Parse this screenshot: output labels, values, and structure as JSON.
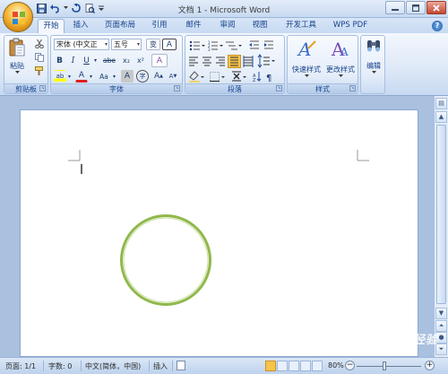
{
  "window": {
    "title": "文档 1 - Microsoft Word"
  },
  "quick_access": {
    "icons": [
      "save-icon",
      "undo-icon",
      "redo-icon",
      "print-preview-icon",
      "customize-dropdown-icon"
    ]
  },
  "tabs": [
    {
      "label": "开始",
      "active": true
    },
    {
      "label": "插入",
      "active": false
    },
    {
      "label": "页面布局",
      "active": false
    },
    {
      "label": "引用",
      "active": false
    },
    {
      "label": "邮件",
      "active": false
    },
    {
      "label": "审阅",
      "active": false
    },
    {
      "label": "视图",
      "active": false
    },
    {
      "label": "开发工具",
      "active": false
    },
    {
      "label": "WPS PDF",
      "active": false
    }
  ],
  "ribbon": {
    "clipboard": {
      "paste_label": "粘贴",
      "group_label": "剪贴板"
    },
    "font": {
      "font_name": "宋体 (中文正",
      "font_size": "五号",
      "phonetic_glyph": "变",
      "border_glyph": "A",
      "bold": "B",
      "italic": "I",
      "underline": "U",
      "strike": "abe",
      "subscript": "x₂",
      "superscript": "x²",
      "clear_glyph": "A",
      "highlight_glyph": "ab",
      "font_color_glyph": "A",
      "case_glyph": "Aa",
      "shade_glyph": "A",
      "enclose_glyph": "字",
      "grow_glyph": "A",
      "shrink_glyph": "A",
      "group_label": "字体"
    },
    "paragraph": {
      "group_label": "段落"
    },
    "styles": {
      "quick_label": "快速样式",
      "change_label": "更改样式",
      "group_label": "样式"
    },
    "editing": {
      "label": "编辑"
    },
    "colors": {
      "accent_blue": "#15428b",
      "font_color_red": "#e02020",
      "highlight_yellow": "#ffff00"
    }
  },
  "document": {
    "shape": "circle",
    "shape_color": "#8fb84a"
  },
  "status": {
    "page": "页面: 1/1",
    "words": "字数: 0",
    "language": "中文(简体，中国)",
    "mode": "插入",
    "zoom": "80%"
  },
  "watermark": {
    "text": "Baidu 经验"
  }
}
